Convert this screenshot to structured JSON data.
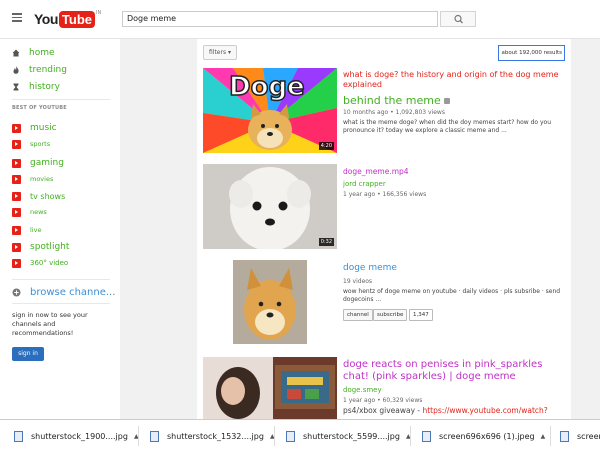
{
  "header": {
    "logo_you": "You",
    "logo_tube": "Tube",
    "logo_region": "IN",
    "search_value": "Doge meme"
  },
  "sidebar": {
    "top_items": [
      {
        "label": "home",
        "icon": "home-icon"
      },
      {
        "label": "trending",
        "icon": "flame-icon"
      },
      {
        "label": "history",
        "icon": "hourglass-icon"
      }
    ],
    "section_title": "BEST OF YOUTUBE",
    "best_items": [
      {
        "label": "music"
      },
      {
        "label": "sports"
      },
      {
        "label": "gaming"
      },
      {
        "label": "movies"
      },
      {
        "label": "tv shows"
      },
      {
        "label": "news"
      },
      {
        "label": "live"
      },
      {
        "label": "spotlight"
      },
      {
        "label": "360° video"
      }
    ],
    "browse_label": "browse channe...",
    "signin_text": "sign in now to see your channels and recommendations!",
    "signin_button": "sign in"
  },
  "main": {
    "filter_label": "filters ▾",
    "results_text": "about 192,000 results",
    "videos": [
      {
        "thumb_text": "Doge",
        "duration": "4:20",
        "title": "what is doge? the history and origin of the dog meme explained",
        "channel": "behind the meme",
        "meta": "10 months ago • 1,092,803 views",
        "desc": "what is the meme doge? when did the doy memes start? how do you pronounce it? today we explore a classic meme and ..."
      },
      {
        "duration": "0:32",
        "title": "doge_meme.mp4",
        "channel": "jord crapper",
        "meta": "1 year ago • 166,356 views"
      },
      {
        "title": "doge meme",
        "meta": "19 videos",
        "desc": "wow hentz of doge meme on youtube · daily videos · pls subsribe · send dogecoins ...",
        "btn_channel": "channel",
        "btn_subscribe": "subscribe",
        "sub_count": "1,347"
      },
      {
        "title": "doge reacts on penises in pink_sparkles chat! (pink sparkles) | doge meme",
        "channel": "doge.smey",
        "meta": "1 year ago • 60,329 views",
        "desc_prefix": "ps4/xbox giveaway - ",
        "desc_link": "https://www.youtube.com/watch?"
      }
    ]
  },
  "downloads": [
    {
      "name": "shutterstock_1900....jpg"
    },
    {
      "name": "shutterstock_1532....jpg"
    },
    {
      "name": "shutterstock_5599....jpg"
    },
    {
      "name": "screen696x696 (1).jpeg"
    },
    {
      "name": "screen"
    }
  ],
  "colors": {
    "accent_red": "#e62117",
    "nav_green": "#43b020",
    "title_magenta": "#c030c8",
    "link_red": "#e62117"
  }
}
